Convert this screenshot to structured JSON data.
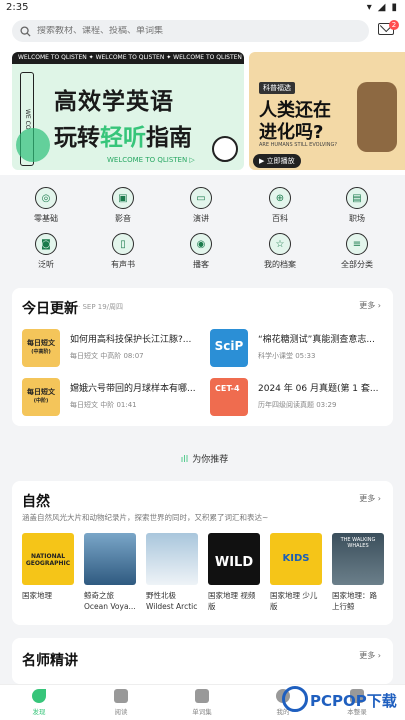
{
  "status": {
    "time": "2:35"
  },
  "search": {
    "placeholder": "搜索教材、课程、投稿、单词集"
  },
  "mail": {
    "badge": "2"
  },
  "banner": {
    "strip": "WELCOME TO QLISTEN ✦ WELCOME TO QLISTEN ✦ WELCOME TO QLISTEN",
    "side_text": "WE CO",
    "line1": "高效学英语",
    "line2_pre": "玩转",
    "line2_hl": "轻听",
    "line2_post": "指南",
    "sub": "WELCOME TO QLISTEN ▷",
    "side_tag": "科普福选",
    "side_line1": "人类还在",
    "side_line2": "进化吗?",
    "side_en": "ARE HUMANS STILL EVOLVING?",
    "side_play": "▶ 立即播放"
  },
  "categories": [
    {
      "label": "零基础",
      "icon": "◎"
    },
    {
      "label": "影音",
      "icon": "▣"
    },
    {
      "label": "演讲",
      "icon": "▭"
    },
    {
      "label": "百科",
      "icon": "⊕"
    },
    {
      "label": "职场",
      "icon": "▤"
    },
    {
      "label": "泛听",
      "icon": "◙"
    },
    {
      "label": "有声书",
      "icon": "▯"
    },
    {
      "label": "播客",
      "icon": "◉"
    },
    {
      "label": "我的档案",
      "icon": "☆"
    },
    {
      "label": "全部分类",
      "icon": "≡"
    }
  ],
  "today": {
    "title": "今日更新",
    "date": "· SEP 19/周四",
    "more": "更多 ›",
    "items": [
      {
        "title": "如何用高科技保护长江江豚?...",
        "meta": "每日短文 中高阶 08:07"
      },
      {
        "title": "“棉花糖测试”真能测查意志...",
        "meta": "科学小课堂 05:33"
      },
      {
        "title": "嫦娥六号带回的月球样本有哪...",
        "meta": "每日短文 中阶 01:41"
      },
      {
        "title": "2024 年 06 月真题(第 1 套...",
        "meta": "历年四级阅读真题 03:29"
      }
    ],
    "thumbs": [
      {
        "label": "每日短文",
        "sub": "(中高阶)"
      },
      {
        "label": "SciP",
        "sub": ""
      },
      {
        "label": "每日短文",
        "sub": "(中阶)"
      },
      {
        "label": "CET-4",
        "sub": ""
      }
    ]
  },
  "recommend": {
    "label": "为你推荐"
  },
  "nature": {
    "title": "自然",
    "more": "更多 ›",
    "desc": "涵盖自然风光大片和动物纪录片，探索世界的同时，又积累了词汇和表达~",
    "books": [
      {
        "line1": "国家地理",
        "line2": "",
        "cover": "NATIONAL GEOGRAPHIC"
      },
      {
        "line1": "鲸奇之旅",
        "line2": "Ocean Voya...",
        "cover": ""
      },
      {
        "line1": "野性北极",
        "line2": "Wildest Arctic",
        "cover": ""
      },
      {
        "line1": "国家地理 视频",
        "line2": "版",
        "cover": "WILD"
      },
      {
        "line1": "国家地理 少儿",
        "line2": "版",
        "cover": "KIDS"
      },
      {
        "line1": "国家地理：路",
        "line2": "上行鲸",
        "cover": "THE WALKING WHALES"
      }
    ]
  },
  "teachers": {
    "title": "名师精讲",
    "more": "更多 ›"
  },
  "tabs": [
    {
      "label": "发现",
      "active": true
    },
    {
      "label": "阅读",
      "active": false
    },
    {
      "label": "单词集",
      "active": false
    },
    {
      "label": "我的",
      "active": false
    },
    {
      "label": "本整录",
      "active": false
    }
  ],
  "watermark": {
    "text": "PCPOP下载"
  },
  "colors": {
    "accent": "#37c57a",
    "badge": "#ff4d4f"
  }
}
